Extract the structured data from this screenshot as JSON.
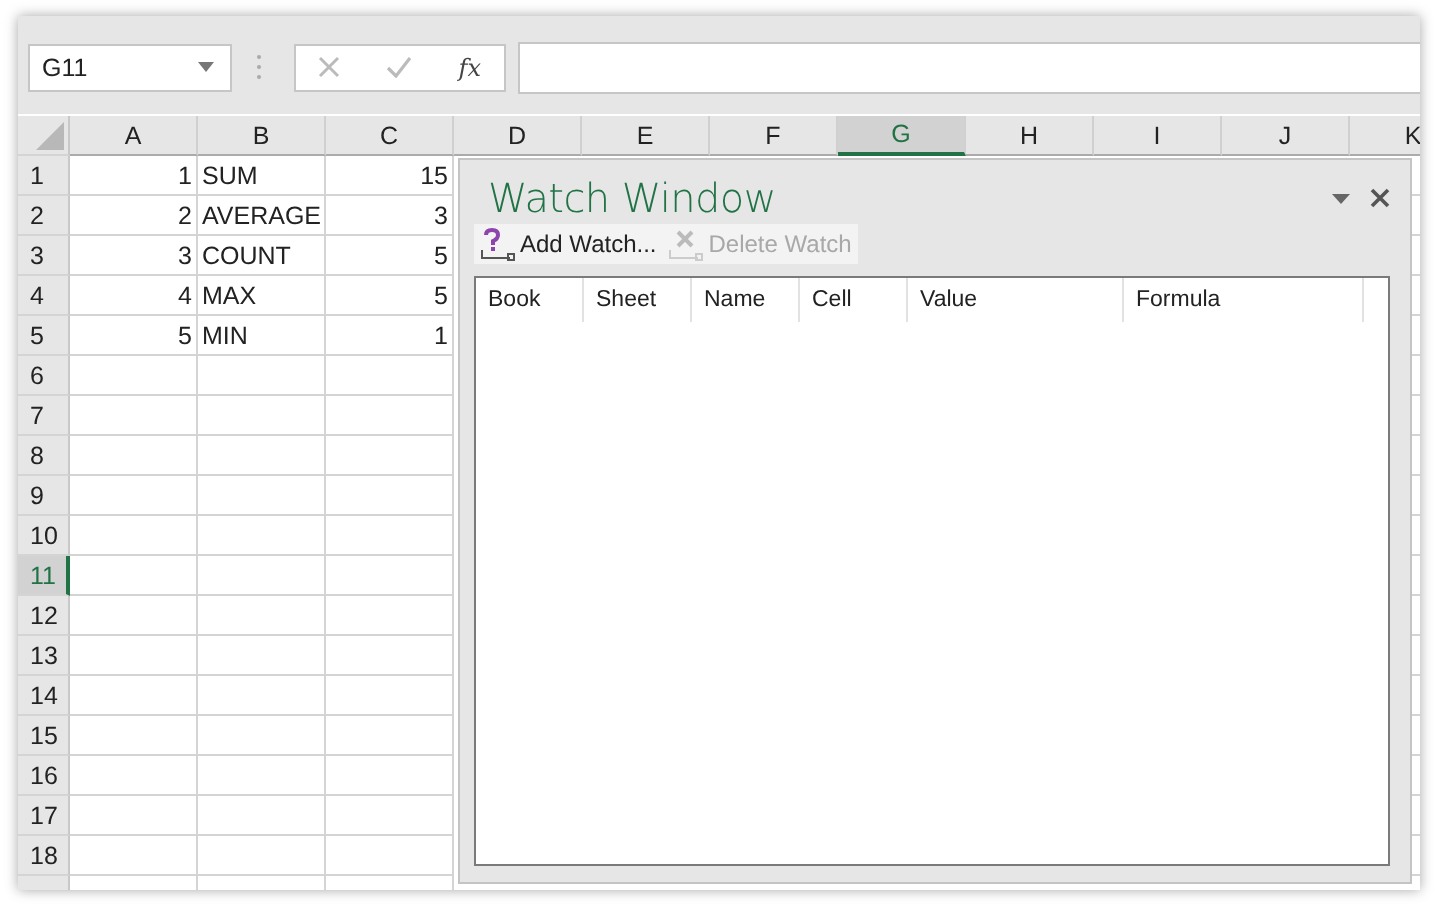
{
  "name_box": {
    "value": "G11"
  },
  "formula_bar": {
    "function_label": "fx"
  },
  "columns": [
    {
      "label": "A",
      "selected": false
    },
    {
      "label": "B",
      "selected": false
    },
    {
      "label": "C",
      "selected": false
    },
    {
      "label": "D",
      "selected": false
    },
    {
      "label": "E",
      "selected": false
    },
    {
      "label": "F",
      "selected": false
    },
    {
      "label": "G",
      "selected": true
    },
    {
      "label": "H",
      "selected": false
    },
    {
      "label": "I",
      "selected": false
    },
    {
      "label": "J",
      "selected": false
    },
    {
      "label": "K",
      "selected": false
    }
  ],
  "rows": [
    {
      "label": "1",
      "selected": false,
      "cells": [
        {
          "text": "1",
          "kind": "number"
        },
        {
          "text": "SUM",
          "kind": "text"
        },
        {
          "text": "15",
          "kind": "number"
        }
      ]
    },
    {
      "label": "2",
      "selected": false,
      "cells": [
        {
          "text": "2",
          "kind": "number"
        },
        {
          "text": "AVERAGE",
          "kind": "text"
        },
        {
          "text": "3",
          "kind": "number"
        }
      ]
    },
    {
      "label": "3",
      "selected": false,
      "cells": [
        {
          "text": "3",
          "kind": "number"
        },
        {
          "text": "COUNT",
          "kind": "text"
        },
        {
          "text": "5",
          "kind": "number"
        }
      ]
    },
    {
      "label": "4",
      "selected": false,
      "cells": [
        {
          "text": "4",
          "kind": "number"
        },
        {
          "text": "MAX",
          "kind": "text"
        },
        {
          "text": "5",
          "kind": "number"
        }
      ]
    },
    {
      "label": "5",
      "selected": false,
      "cells": [
        {
          "text": "5",
          "kind": "number"
        },
        {
          "text": "MIN",
          "kind": "text"
        },
        {
          "text": "1",
          "kind": "number"
        }
      ]
    },
    {
      "label": "6",
      "selected": false
    },
    {
      "label": "7",
      "selected": false
    },
    {
      "label": "8",
      "selected": false
    },
    {
      "label": "9",
      "selected": false
    },
    {
      "label": "10",
      "selected": false
    },
    {
      "label": "11",
      "selected": true
    },
    {
      "label": "12",
      "selected": false
    },
    {
      "label": "13",
      "selected": false
    },
    {
      "label": "14",
      "selected": false
    },
    {
      "label": "15",
      "selected": false
    },
    {
      "label": "16",
      "selected": false
    },
    {
      "label": "17",
      "selected": false
    },
    {
      "label": "18",
      "selected": false
    }
  ],
  "watch_window": {
    "title": "Watch Window",
    "toolbar": [
      {
        "label": "Add Watch...",
        "kind": "add",
        "disabled": false
      },
      {
        "label": "Delete Watch",
        "kind": "delete",
        "disabled": true
      }
    ],
    "columns": [
      "Book",
      "Sheet",
      "Name",
      "Cell",
      "Value",
      "Formula"
    ]
  }
}
